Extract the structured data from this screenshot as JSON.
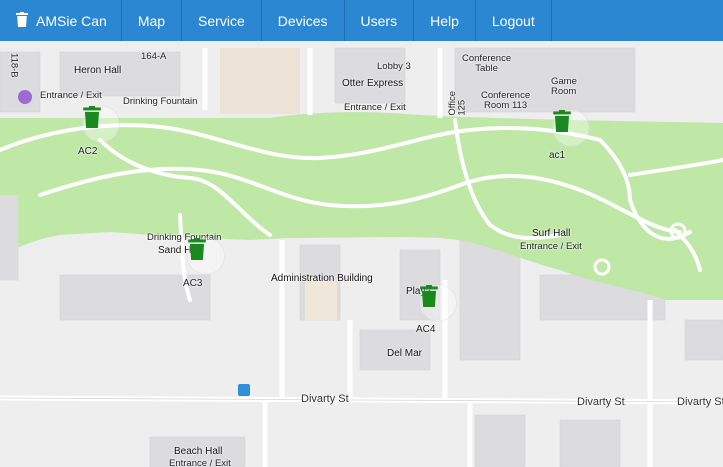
{
  "nav": {
    "brand": "AMSie Can",
    "items": [
      "Map",
      "Service",
      "Devices",
      "Users",
      "Help",
      "Logout"
    ]
  },
  "colors": {
    "navbar": "#2b87d1",
    "park": "#bfe8a7",
    "marker_green": "#1a8a1f"
  },
  "icons": {
    "brand": "trash-can-icon",
    "marker": "trash-can-icon",
    "entrance": "person-walking-icon",
    "bus": "bus-stop-icon"
  },
  "map": {
    "places": {
      "heron_hall": "Heron Hall",
      "b164a": "164-A",
      "b118b": "118-B",
      "entrance_exit_1": "Entrance / Exit",
      "drinking_fountain_1": "Drinking Fountain",
      "lobby3": "Lobby 3",
      "otter_express": "Otter Express",
      "entrance_exit_2": "Entrance / Exit",
      "conference_table": "Conference\nTable",
      "game_room": "Game\nRoom",
      "conference_room": "Conference\nRoom 113",
      "office125": "Office\n125",
      "drinking_fountain_2": "Drinking Fountain",
      "sand_hall": "Sand Hall",
      "surf_hall": "Surf Hall",
      "entrance_exit_3": "Entrance / Exit",
      "admin_building": "Administration Building",
      "playa": "Playa",
      "del_mar": "Del Mar",
      "beach_hall": "Beach Hall",
      "entrance_exit_4": "Entrance / Exit"
    },
    "streets": {
      "s1": "Divarty St",
      "s2": "Divarty St",
      "s3": "Divarty St"
    },
    "markers": {
      "ac2": "AC2",
      "ac1": "ac1",
      "ac3": "AC3",
      "ac4": "AC4"
    }
  }
}
